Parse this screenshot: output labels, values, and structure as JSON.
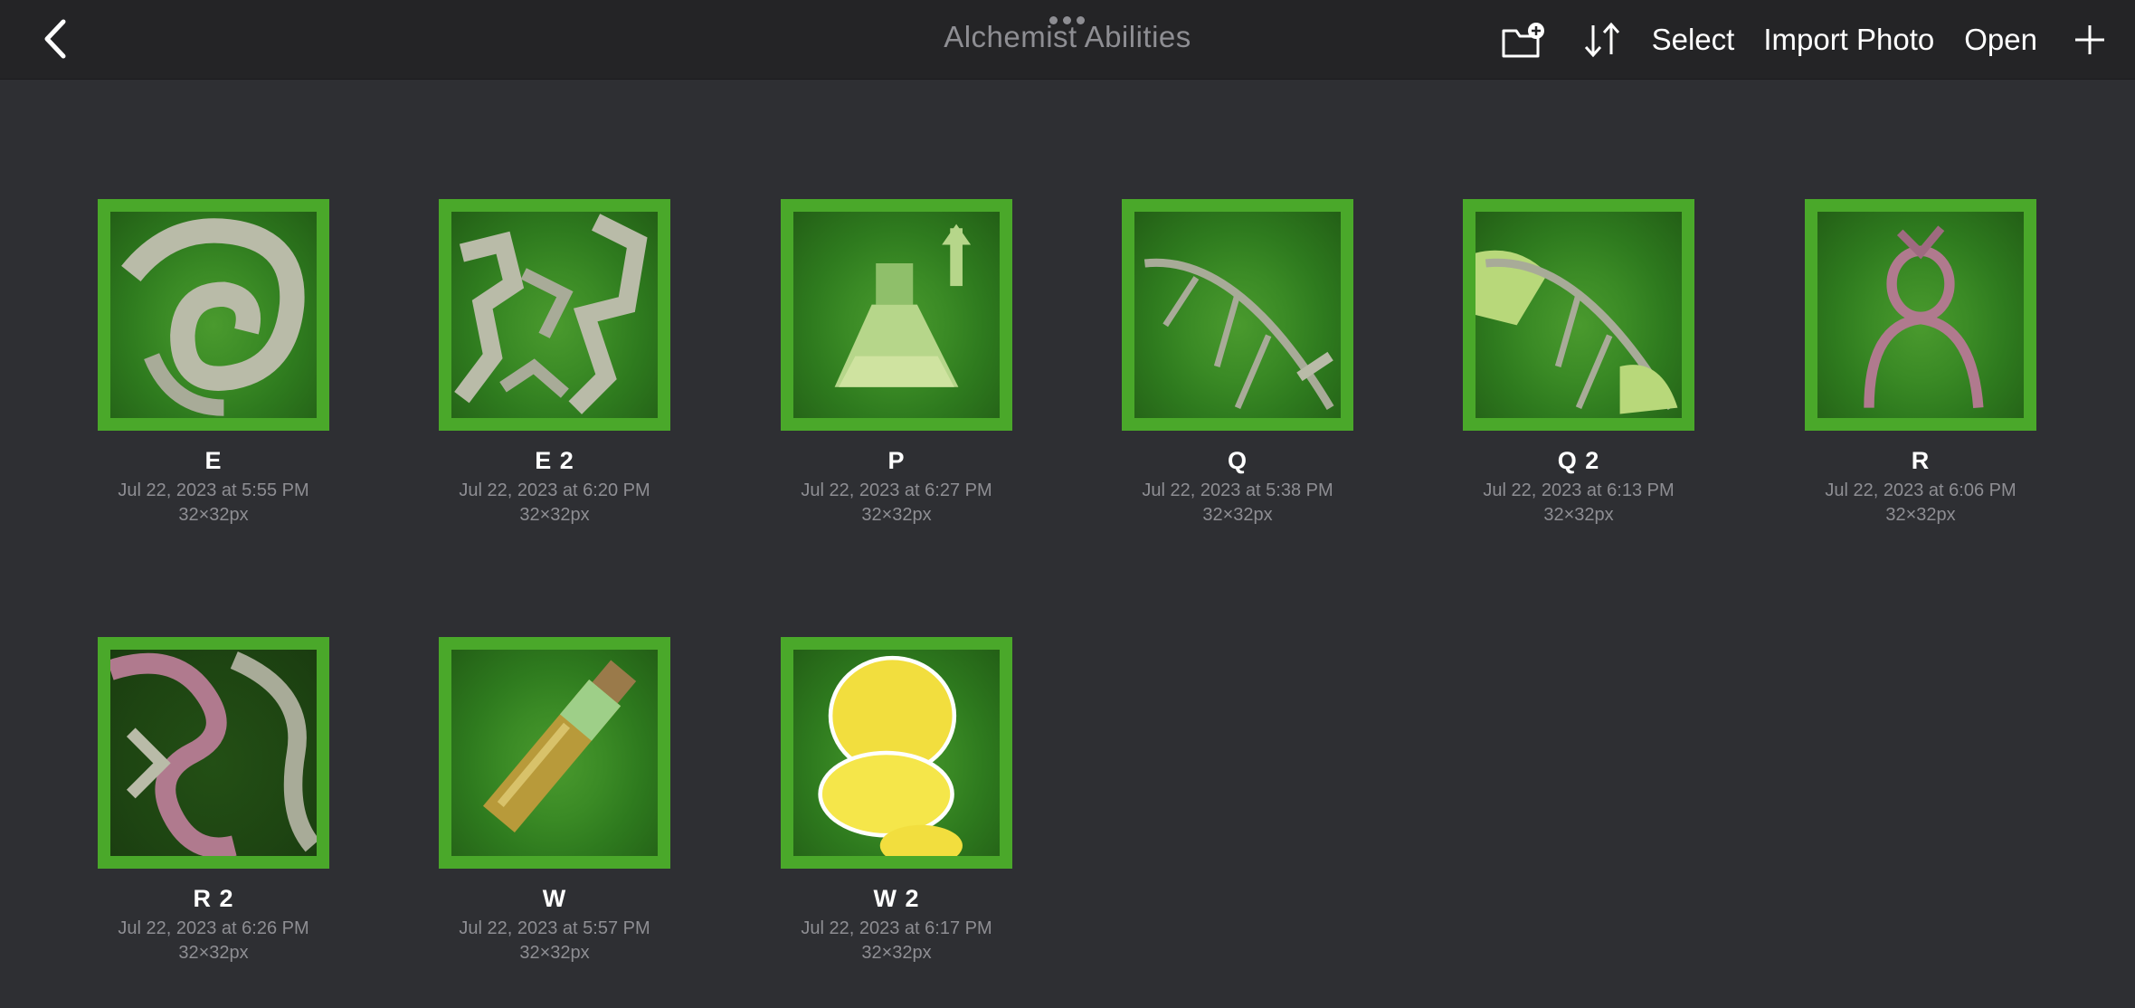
{
  "header": {
    "title": "Alchemist Abilities",
    "back_icon": "chevron-left-icon",
    "actions": {
      "new_folder_icon": "folder-plus-icon",
      "sort_icon": "sort-arrows-icon",
      "select_label": "Select",
      "import_label": "Import Photo",
      "open_label": "Open",
      "add_icon": "plus-icon"
    }
  },
  "colors": {
    "background": "#2e2f33",
    "topbar": "#242426",
    "thumb_border": "#4aa82a",
    "muted_text": "#8e8e93"
  },
  "files": [
    {
      "name": "E",
      "date": "Jul 22, 2023 at 5:55 PM",
      "size": "32×32px",
      "art": "swirl-icon"
    },
    {
      "name": "E 2",
      "date": "Jul 22, 2023 at 6:20 PM",
      "size": "32×32px",
      "art": "splatter-icon"
    },
    {
      "name": "P",
      "date": "Jul 22, 2023 at 6:27 PM",
      "size": "32×32px",
      "art": "flask-icon"
    },
    {
      "name": "Q",
      "date": "Jul 22, 2023 at 5:38 PM",
      "size": "32×32px",
      "art": "leaf-icon"
    },
    {
      "name": "Q 2",
      "date": "Jul 22, 2023 at 6:13 PM",
      "size": "32×32px",
      "art": "leaf-glow-icon"
    },
    {
      "name": "R",
      "date": "Jul 22, 2023 at 6:06 PM",
      "size": "32×32px",
      "art": "silhouette-icon"
    },
    {
      "name": "R 2",
      "date": "Jul 22, 2023 at 6:26 PM",
      "size": "32×32px",
      "art": "vines-icon"
    },
    {
      "name": "W",
      "date": "Jul 22, 2023 at 5:57 PM",
      "size": "32×32px",
      "art": "vial-icon"
    },
    {
      "name": "W 2",
      "date": "Jul 22, 2023 at 6:17 PM",
      "size": "32×32px",
      "art": "gold-blob-icon"
    }
  ]
}
